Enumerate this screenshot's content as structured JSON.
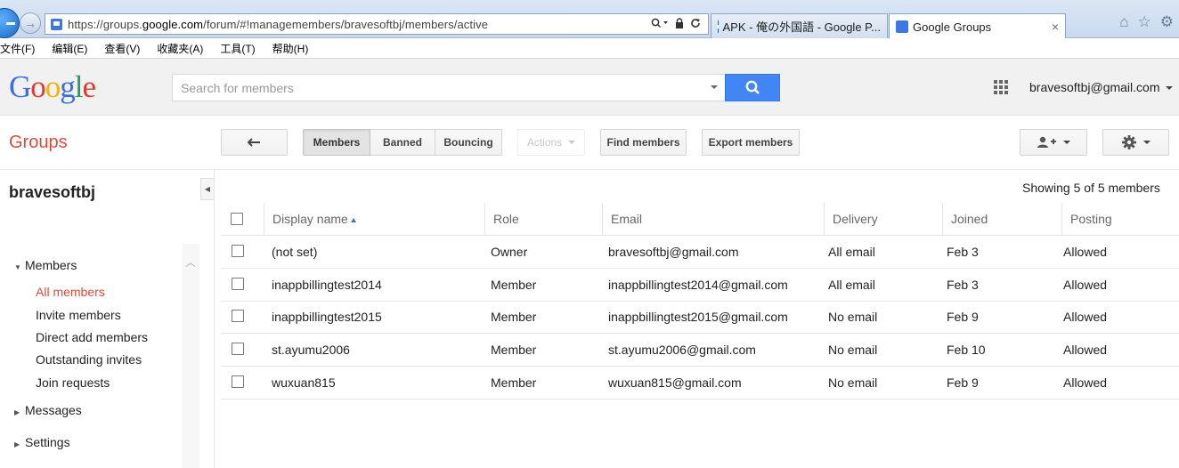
{
  "browser": {
    "url_prefix": "https://groups.",
    "url_domain": "google.com",
    "url_suffix": "/forum/#!managemembers/bravesoftbj/members/active",
    "tabs": [
      {
        "label": "APK - 俺の外国語 - Google P..."
      },
      {
        "label": "Google Groups"
      }
    ],
    "menu": [
      "文件(F)",
      "编辑(E)",
      "查看(V)",
      "收藏夹(A)",
      "工具(T)",
      "帮助(H)"
    ]
  },
  "google_bar": {
    "logo": [
      "G",
      "o",
      "o",
      "g",
      "l",
      "e"
    ],
    "search_placeholder": "Search for members",
    "account": "bravesoftbj@gmail.com"
  },
  "toolbar": {
    "app_title": "Groups",
    "members_label": "Members",
    "banned_label": "Banned",
    "bouncing_label": "Bouncing",
    "actions_label": "Actions",
    "find_members_label": "Find members",
    "export_members_label": "Export members"
  },
  "sidebar": {
    "group_name": "bravesoftbj",
    "members_section": "Members",
    "items": [
      {
        "label": "All members"
      },
      {
        "label": "Invite members"
      },
      {
        "label": "Direct add members"
      },
      {
        "label": "Outstanding invites"
      },
      {
        "label": "Join requests"
      }
    ],
    "messages_section": "Messages",
    "settings_section": "Settings"
  },
  "table": {
    "showing": "Showing 5 of 5 members",
    "headers": {
      "display_name": "Display name",
      "role": "Role",
      "email": "Email",
      "delivery": "Delivery",
      "joined": "Joined",
      "posting": "Posting"
    },
    "rows": [
      {
        "name": "(not set)",
        "role": "Owner",
        "email": "bravesoftbj@gmail.com",
        "delivery": "All email",
        "joined": "Feb 3",
        "posting": "Allowed"
      },
      {
        "name": "inappbillingtest2014",
        "role": "Member",
        "email": "inappbillingtest2014@gmail.com",
        "delivery": "All email",
        "joined": "Feb 3",
        "posting": "Allowed"
      },
      {
        "name": "inappbillingtest2015",
        "role": "Member",
        "email": "inappbillingtest2015@gmail.com",
        "delivery": "No email",
        "joined": "Feb 9",
        "posting": "Allowed"
      },
      {
        "name": "st.ayumu2006",
        "role": "Member",
        "email": "st.ayumu2006@gmail.com",
        "delivery": "No email",
        "joined": "Feb 10",
        "posting": "Allowed"
      },
      {
        "name": "wuxuan815",
        "role": "Member",
        "email": "wuxuan815@gmail.com",
        "delivery": "No email",
        "joined": "Feb 9",
        "posting": "Allowed"
      }
    ]
  },
  "colors": {
    "accent_red": "#dd4b39",
    "search_blue": "#4285f4"
  }
}
